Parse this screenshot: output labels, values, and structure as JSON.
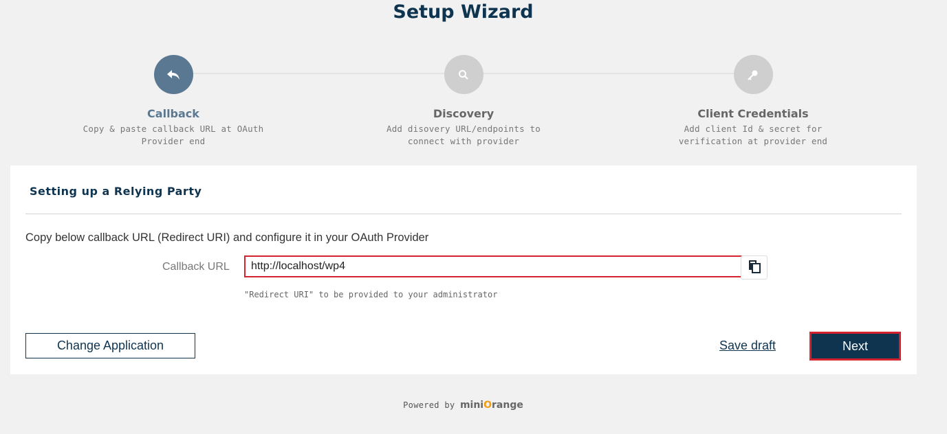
{
  "header": {
    "title": "Setup Wizard"
  },
  "steps": [
    {
      "title": "Callback",
      "desc_line1": "Copy & paste callback URL at OAuth",
      "desc_line2": "Provider end",
      "icon": "reply-arrow-icon",
      "active": true
    },
    {
      "title": "Discovery",
      "desc_line1": "Add disovery URL/endpoints to",
      "desc_line2": "connect with provider",
      "icon": "search-icon",
      "active": false
    },
    {
      "title": "Client Credentials",
      "desc_line1": "Add client Id & secret for",
      "desc_line2": "verification at provider end",
      "icon": "key-icon",
      "active": false
    }
  ],
  "card": {
    "title": "Setting up a Relying Party",
    "instruction": "Copy below callback URL (Redirect URI) and configure it in your OAuth Provider",
    "callback_label": "Callback URL",
    "callback_value": "http://localhost/wp4",
    "hint": "\"Redirect URI\" to be provided to your administrator",
    "change_application": "Change Application",
    "save_draft": "Save draft",
    "next": "Next"
  },
  "footer": {
    "powered_by": "Powered by",
    "brand_part1": "mini",
    "brand_o": "O",
    "brand_part2": "range"
  },
  "colors": {
    "navy": "#0f3450",
    "active_step": "#5a7891",
    "inactive_step": "#cfcfcf",
    "highlight_red": "#d4232f"
  }
}
